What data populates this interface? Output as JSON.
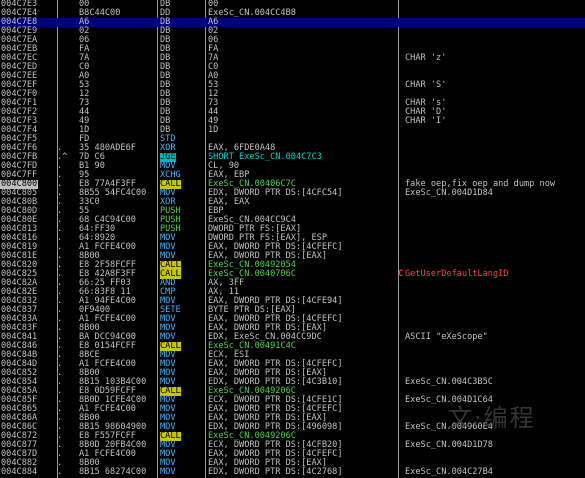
{
  "rows": [
    {
      "address": "004C7E3",
      "mark": "",
      "hex": "00",
      "mnemonic": "DB",
      "operand": "00",
      "comment": "",
      "type": "data"
    },
    {
      "address": "004C7E4",
      "mark": "",
      "hex": "B8C44C00",
      "mnemonic": "DD",
      "operand": "ExeSc_CN.004CC4B8",
      "comment": "",
      "type": "data"
    },
    {
      "address": "004C7E8",
      "mark": "",
      "hex": "A6",
      "mnemonic": "DB",
      "operand": "A6",
      "comment": "",
      "type": "data",
      "selected": true
    },
    {
      "address": "004C7E9",
      "mark": "",
      "hex": "02",
      "mnemonic": "DB",
      "operand": "02",
      "comment": "",
      "type": "data"
    },
    {
      "address": "004C7EA",
      "mark": "",
      "hex": "06",
      "mnemonic": "DB",
      "operand": "06",
      "comment": "",
      "type": "data"
    },
    {
      "address": "004C7EB",
      "mark": "",
      "hex": "FA",
      "mnemonic": "DB",
      "operand": "FA",
      "comment": "",
      "type": "data"
    },
    {
      "address": "004C7EC",
      "mark": "",
      "hex": "7A",
      "mnemonic": "DB",
      "operand": "7A",
      "comment": "CHAR 'z'",
      "type": "data"
    },
    {
      "address": "004C7ED",
      "mark": "",
      "hex": "C0",
      "mnemonic": "DB",
      "operand": "C0",
      "comment": "",
      "type": "data"
    },
    {
      "address": "004C7EE",
      "mark": "",
      "hex": "A0",
      "mnemonic": "DB",
      "operand": "A0",
      "comment": "",
      "type": "data"
    },
    {
      "address": "004C7EF",
      "mark": "",
      "hex": "53",
      "mnemonic": "DB",
      "operand": "53",
      "comment": "CHAR 'S'",
      "type": "data"
    },
    {
      "address": "004C7F0",
      "mark": "",
      "hex": "12",
      "mnemonic": "DB",
      "operand": "12",
      "comment": "",
      "type": "data"
    },
    {
      "address": "004C7F1",
      "mark": "",
      "hex": "73",
      "mnemonic": "DB",
      "operand": "73",
      "comment": "CHAR 's'",
      "type": "data"
    },
    {
      "address": "004C7F2",
      "mark": "",
      "hex": "44",
      "mnemonic": "DB",
      "operand": "44",
      "comment": "CHAR 'D'",
      "type": "data"
    },
    {
      "address": "004C7F3",
      "mark": "",
      "hex": "49",
      "mnemonic": "DB",
      "operand": "49",
      "comment": "CHAR 'I'",
      "type": "data"
    },
    {
      "address": "004C7F4",
      "mark": "",
      "hex": "1D",
      "mnemonic": "DB",
      "operand": "1D",
      "comment": "",
      "type": "data"
    },
    {
      "address": "004C7F5",
      "mark": "",
      "hex": "FD",
      "mnemonic": "STD",
      "operand": "",
      "comment": "",
      "type": "norm"
    },
    {
      "address": "004C7F6",
      "mark": ".",
      "hex": "35 480ADE6F",
      "mnemonic": "XOR",
      "operand": "EAX, 6FDE0A48",
      "comment": "",
      "type": "norm"
    },
    {
      "address": "004C7FB",
      "mark": ".^",
      "hex": "7D C6",
      "mnemonic": "JGE",
      "operand": "SHORT ExeSc_CN.004C7C3",
      "comment": "",
      "type": "jmp"
    },
    {
      "address": "004C7FD",
      "mark": ".",
      "hex": "B1 90",
      "mnemonic": "MOV",
      "operand": "CL, 90",
      "comment": "",
      "type": "norm"
    },
    {
      "address": "004C7FF",
      "mark": ".",
      "hex": "95",
      "mnemonic": "XCHG",
      "operand": "EAX, EBP",
      "comment": "",
      "type": "norm"
    },
    {
      "address": "004C800",
      "mark": ".",
      "hex": "E8 77A4F3FF",
      "mnemonic": "CALL",
      "operand": "ExeSc_CN.00406C7C",
      "comment": "fake oep,fix oep and dump now",
      "type": "call",
      "eip": true
    },
    {
      "address": "004C805",
      "mark": ".",
      "hex": "8B55 54FC4C00",
      "mnemonic": "MOV",
      "operand": "EDX, DWORD PTR DS:[4CFC54]",
      "comment": "ExeSc_CN.004D1D84",
      "type": "norm"
    },
    {
      "address": "004C80B",
      "mark": ".",
      "hex": "33C0",
      "mnemonic": "XOR",
      "operand": "EAX, EAX",
      "comment": "",
      "type": "norm"
    },
    {
      "address": "004C80D",
      "mark": ".",
      "hex": "55",
      "mnemonic": "PUSH",
      "operand": "EBP",
      "comment": "",
      "type": "push"
    },
    {
      "address": "004C80E",
      "mark": ".",
      "hex": "68 C4C94C00",
      "mnemonic": "PUSH",
      "operand": "ExeSc_CN.004CC9C4",
      "comment": "",
      "type": "push"
    },
    {
      "address": "004C813",
      "mark": ".",
      "hex": "64:FF30",
      "mnemonic": "PUSH",
      "operand": "DWORD PTR FS:[EAX]",
      "comment": "",
      "type": "push"
    },
    {
      "address": "004C816",
      "mark": ".",
      "hex": "64:8920",
      "mnemonic": "MOV",
      "operand": "DWORD PTR FS:[EAX], ESP",
      "comment": "",
      "type": "norm"
    },
    {
      "address": "004C819",
      "mark": ".",
      "hex": "A1 FCFE4C00",
      "mnemonic": "MOV",
      "operand": "EAX, DWORD PTR DS:[4CFEFC]",
      "comment": "",
      "type": "norm"
    },
    {
      "address": "004C81E",
      "mark": ".",
      "hex": "8B00",
      "mnemonic": "MOV",
      "operand": "EAX, DWORD PTR DS:[EAX]",
      "comment": "",
      "type": "norm"
    },
    {
      "address": "004C820",
      "mark": ".",
      "hex": "E8 2F58FCFF",
      "mnemonic": "CALL",
      "operand": "ExeSc_CN.00492054",
      "comment": "",
      "type": "call"
    },
    {
      "address": "004C825",
      "mark": ".",
      "hex": "E8 42A8F3FF",
      "mnemonic": "CALL",
      "operand": "ExeSc_CN.0040706C",
      "comment": "GetUserDefaultLangID",
      "type": "call",
      "api": true
    },
    {
      "address": "004C82A",
      "mark": ".",
      "hex": "66:25 FF03",
      "mnemonic": "AND",
      "operand": "AX, 3FF",
      "comment": "",
      "type": "norm"
    },
    {
      "address": "004C82E",
      "mark": ".",
      "hex": "66:83F8 11",
      "mnemonic": "CMP",
      "operand": "AX, 11",
      "comment": "",
      "type": "norm"
    },
    {
      "address": "004C832",
      "mark": ".",
      "hex": "A1 94FE4C00",
      "mnemonic": "MOV",
      "operand": "EAX, DWORD PTR DS:[4CFE94]",
      "comment": "",
      "type": "norm"
    },
    {
      "address": "004C837",
      "mark": ".",
      "hex": "0F9400",
      "mnemonic": "SETE",
      "operand": "BYTE PTR DS:[EAX]",
      "comment": "",
      "type": "norm"
    },
    {
      "address": "004C83A",
      "mark": ".",
      "hex": "A1 FCFE4C00",
      "mnemonic": "MOV",
      "operand": "EAX, DWORD PTR DS:[4CFEFC]",
      "comment": "",
      "type": "norm"
    },
    {
      "address": "004C83F",
      "mark": ".",
      "hex": "8B00",
      "mnemonic": "MOV",
      "operand": "EAX, DWORD PTR DS:[EAX]",
      "comment": "",
      "type": "norm"
    },
    {
      "address": "004C841",
      "mark": ".",
      "hex": "BA DCC94C00",
      "mnemonic": "MOV",
      "operand": "EDX, ExeSc_CN.004CC9DC",
      "comment": "ASCII \"eXeScope\"",
      "type": "norm"
    },
    {
      "address": "004C846",
      "mark": ".",
      "hex": "E8 0154FCFF",
      "mnemonic": "CALL",
      "operand": "ExeSc_CN.00491C4C",
      "comment": "",
      "type": "call"
    },
    {
      "address": "004C84B",
      "mark": ".",
      "hex": "8BCE",
      "mnemonic": "MOV",
      "operand": "ECX, ESI",
      "comment": "",
      "type": "norm"
    },
    {
      "address": "004C84D",
      "mark": ".",
      "hex": "A1 FCFE4C00",
      "mnemonic": "MOV",
      "operand": "EAX, DWORD PTR DS:[4CFEFC]",
      "comment": "",
      "type": "norm"
    },
    {
      "address": "004C852",
      "mark": ".",
      "hex": "8B00",
      "mnemonic": "MOV",
      "operand": "EAX, DWORD PTR DS:[EAX]",
      "comment": "",
      "type": "norm"
    },
    {
      "address": "004C854",
      "mark": ".",
      "hex": "8B15 103B4C00",
      "mnemonic": "MOV",
      "operand": "EDX, DWORD PTR DS:[4C3B10]",
      "comment": "ExeSc_CN.004C3B5C",
      "type": "norm"
    },
    {
      "address": "004C85A",
      "mark": ".",
      "hex": "E8 0D59FCFF",
      "mnemonic": "CALL",
      "operand": "ExeSc_CN.0049206C",
      "comment": "",
      "type": "call"
    },
    {
      "address": "004C85F",
      "mark": ".",
      "hex": "8B0D 1CFE4C00",
      "mnemonic": "MOV",
      "operand": "ECX, DWORD PTR DS:[4CFE1C]",
      "comment": "ExeSc_CN.004D1C64",
      "type": "norm"
    },
    {
      "address": "004C865",
      "mark": ".",
      "hex": "A1 FCFE4C00",
      "mnemonic": "MOV",
      "operand": "EAX, DWORD PTR DS:[4CFEFC]",
      "comment": "",
      "type": "norm"
    },
    {
      "address": "004C86A",
      "mark": ".",
      "hex": "8B00",
      "mnemonic": "MOV",
      "operand": "EAX, DWORD PTR DS:[EAX]",
      "comment": "",
      "type": "norm"
    },
    {
      "address": "004C86C",
      "mark": ".",
      "hex": "8B15 98604900",
      "mnemonic": "MOV",
      "operand": "EDX, DWORD PTR DS:[496098]",
      "comment": "ExeSc_CN.004960E4",
      "type": "norm"
    },
    {
      "address": "004C872",
      "mark": ".",
      "hex": "E8 F557FCFF",
      "mnemonic": "CALL",
      "operand": "ExeSc_CN.0049206C",
      "comment": "",
      "type": "call"
    },
    {
      "address": "004C877",
      "mark": ".",
      "hex": "8B0D 20FB4C00",
      "mnemonic": "MOV",
      "operand": "ECX, DWORD PTR DS:[4CFB20]",
      "comment": "ExeSc_CN.004D1D78",
      "type": "norm"
    },
    {
      "address": "004C87D",
      "mark": ".",
      "hex": "A1 FCFE4C00",
      "mnemonic": "MOV",
      "operand": "EAX, DWORD PTR DS:[4CFEFC]",
      "comment": "",
      "type": "norm"
    },
    {
      "address": "004C882",
      "mark": ".",
      "hex": "8B00",
      "mnemonic": "MOV",
      "operand": "EAX, DWORD PTR DS:[EAX]",
      "comment": "",
      "type": "norm"
    },
    {
      "address": "004C884",
      "mark": ".",
      "hex": "8B15 68274C00",
      "mnemonic": "MOV",
      "operand": "EDX, DWORD PTR DS:[4C2768]",
      "comment": "ExeSc_CN.004C27B4",
      "type": "norm"
    }
  ],
  "api_badge": "C",
  "watermark": "文·编程",
  "colors": {
    "background": "#000000",
    "selection": "#000080",
    "call_highlight": "#c8c800",
    "jump_highlight": "#00b4b4",
    "api_comment": "#ff4040"
  }
}
